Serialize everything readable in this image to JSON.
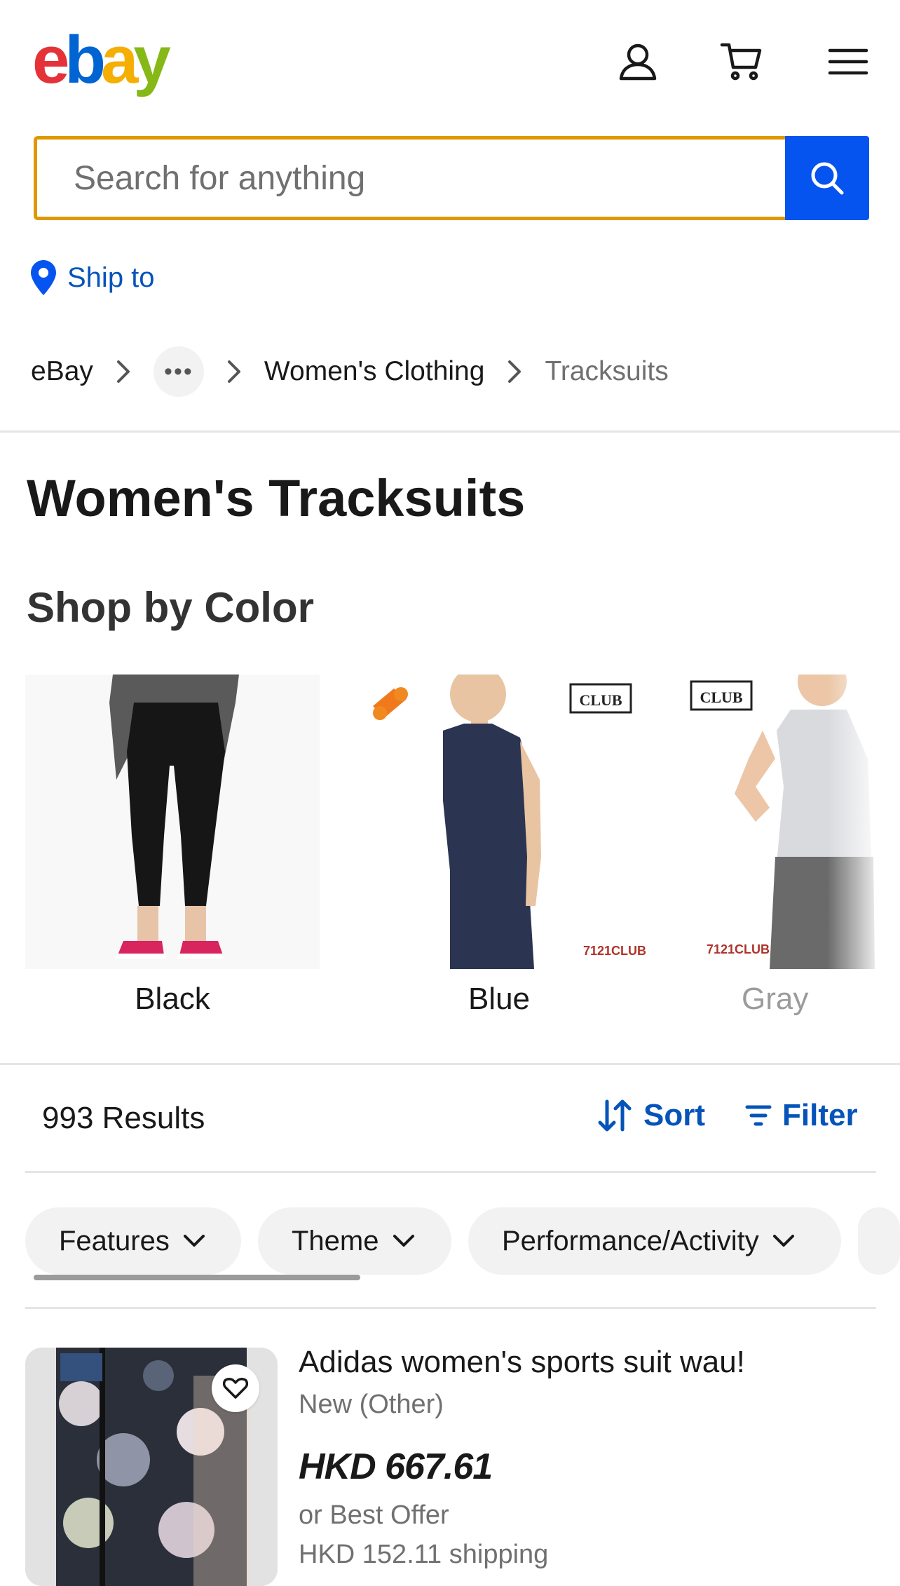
{
  "header": {
    "logo_letters": [
      "e",
      "b",
      "a",
      "y"
    ],
    "logo_colors": [
      "#e53238",
      "#0064d2",
      "#f5af02",
      "#86b817"
    ],
    "icons": [
      "account-icon",
      "cart-icon",
      "menu-icon"
    ]
  },
  "search": {
    "placeholder": "Search for anything",
    "value": "",
    "button_icon": "search-icon"
  },
  "ship_to": {
    "label": "Ship to",
    "icon": "location-pin-icon"
  },
  "breadcrumb": {
    "items": [
      "eBay",
      "Women's Clothing",
      "Tracksuits"
    ],
    "overflow_icon": "more-icon"
  },
  "page": {
    "title": "Women's Tracksuits"
  },
  "shop_by_color": {
    "title": "Shop by Color",
    "tiles": [
      {
        "label": "Black"
      },
      {
        "label": "Blue"
      },
      {
        "label": "Gray"
      }
    ]
  },
  "results": {
    "count": "993 Results",
    "sort_label": "Sort",
    "filter_label": "Filter"
  },
  "chips": [
    {
      "label": "Features"
    },
    {
      "label": "Theme"
    },
    {
      "label": "Performance/Activity"
    }
  ],
  "listing": {
    "title": "Adidas women's sports suit wau!",
    "condition": "New (Other)",
    "price": "HKD 667.61",
    "offer": "or Best Offer",
    "shipping": "HKD 152.11 shipping"
  },
  "colors": {
    "accent_blue": "#0654ba",
    "search_button": "#0654f0",
    "search_border": "#e09800"
  }
}
